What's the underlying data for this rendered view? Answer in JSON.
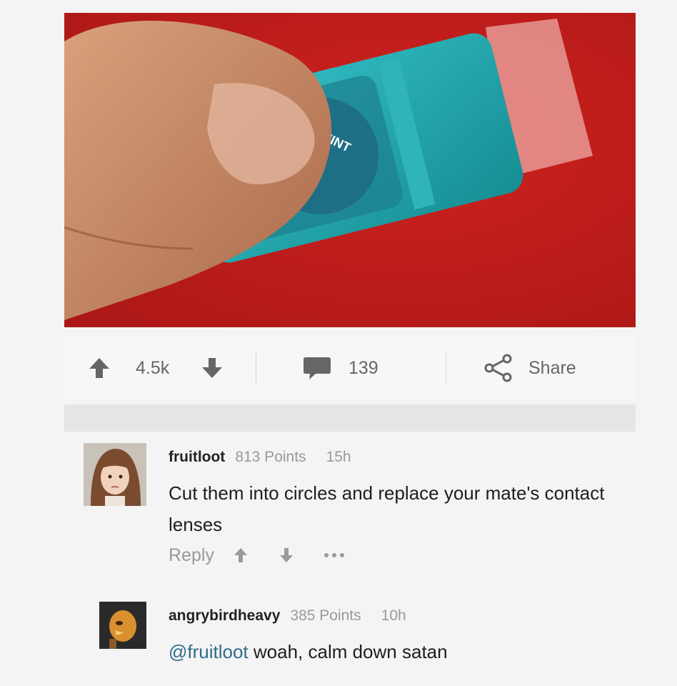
{
  "post": {
    "image_alt": "Hand holding teal dental floss container labelled Cool Mint with a clear strip"
  },
  "action_bar": {
    "upvote_count": "4.5k",
    "comment_count": "139",
    "share_label": "Share"
  },
  "comments": [
    {
      "username": "fruitloot",
      "points": "813 Points",
      "time": "15h",
      "text": "Cut them into circles and replace your mate's contact lenses",
      "reply_label": "Reply"
    },
    {
      "username": "angrybirdheavy",
      "points": "385 Points",
      "time": "10h",
      "mention": "@fruitloot",
      "text": " woah, calm down satan"
    }
  ],
  "colors": {
    "icon": "#666666",
    "mention": "#2f6d8a",
    "background": "#f4f4f4"
  }
}
